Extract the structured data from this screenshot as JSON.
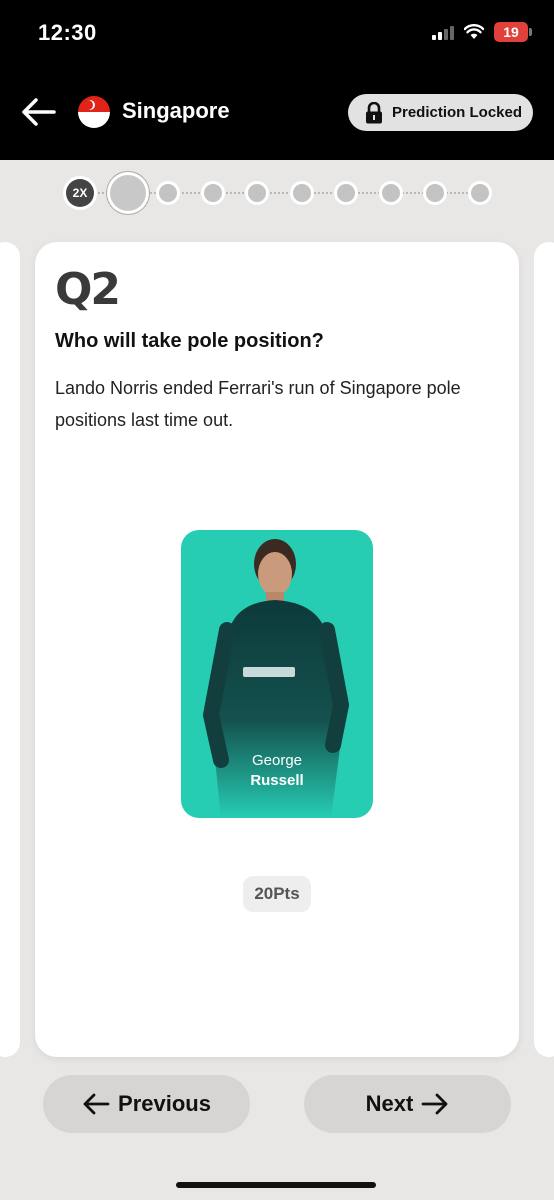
{
  "status_bar": {
    "time": "12:30",
    "battery": "19"
  },
  "header": {
    "race_name": "Singapore",
    "lock_label": "Prediction Locked"
  },
  "progress": {
    "multiplier_label": "2X",
    "total_dots": 10,
    "current_index": 1
  },
  "card": {
    "question_number": "Q2",
    "question": "Who will take pole position?",
    "description": "Lando Norris ended Ferrari's run of Singapore pole positions last time out.",
    "selected_driver": {
      "first_name": "George",
      "last_name": "Russell",
      "card_color": "#26cdb3"
    },
    "points": "20Pts"
  },
  "navigation": {
    "previous_label": "Previous",
    "next_label": "Next"
  }
}
